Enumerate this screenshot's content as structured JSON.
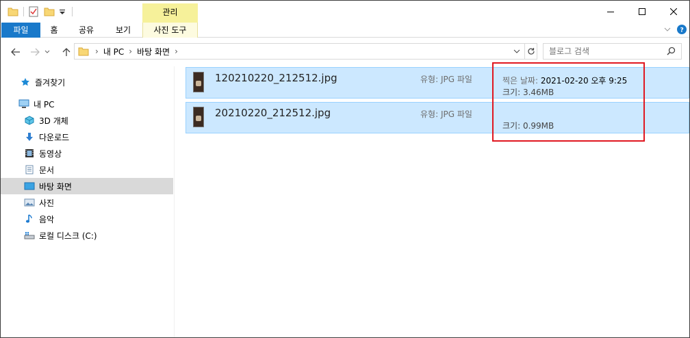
{
  "titlebar": {
    "context_tab": "관리",
    "controls": [
      "minimize-icon",
      "maximize-icon",
      "close-icon"
    ]
  },
  "ribbon": {
    "tabs": [
      {
        "label": "파일"
      },
      {
        "label": "홈"
      },
      {
        "label": "공유"
      },
      {
        "label": "보기"
      },
      {
        "label": "사진 도구"
      }
    ]
  },
  "address": {
    "path": [
      "내 PC",
      "바탕 화면"
    ]
  },
  "search": {
    "placeholder": "블로그 검색"
  },
  "sidebar": {
    "items": [
      {
        "label": "즐겨찾기",
        "icon": "star-icon"
      },
      {
        "label": "내 PC",
        "icon": "pc-icon"
      },
      {
        "label": "3D 개체",
        "icon": "cube-icon"
      },
      {
        "label": "다운로드",
        "icon": "download-icon"
      },
      {
        "label": "동영상",
        "icon": "video-icon"
      },
      {
        "label": "문서",
        "icon": "document-icon"
      },
      {
        "label": "바탕 화면",
        "icon": "desktop-icon",
        "selected": true
      },
      {
        "label": "사진",
        "icon": "pictures-icon"
      },
      {
        "label": "음악",
        "icon": "music-icon"
      },
      {
        "label": "로컬 디스크 (C:)",
        "icon": "drive-icon"
      }
    ]
  },
  "files": [
    {
      "name": "120210220_212512.jpg",
      "type_label": "유형: JPG 파일",
      "date_label": "찍은 날짜: ",
      "date": "2021-02-20 오후 9:25",
      "size_label": "크기: 3.46MB"
    },
    {
      "name": "20210220_212512.jpg",
      "type_label": "유형: JPG 파일",
      "size_label": "크기: 0.99MB"
    }
  ],
  "colors": {
    "file_tab": "#1979ca",
    "context_tab": "#f6f19a",
    "selection": "#cce8ff",
    "highlight_box": "#e0161f"
  }
}
